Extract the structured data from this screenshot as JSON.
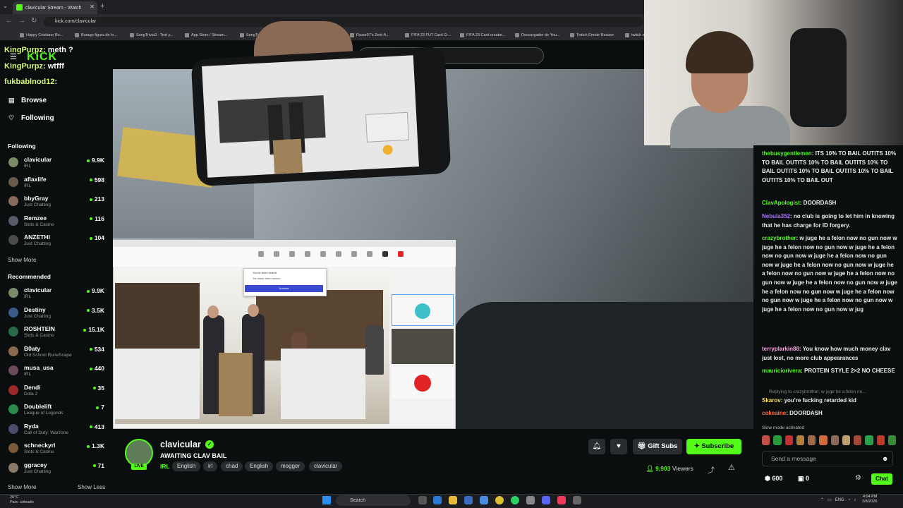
{
  "browser": {
    "tab_title": "clavicular Stream - Watch",
    "url": "kick.com/clavicular",
    "bookmarks": [
      "Happy Cristiano Ro...",
      "Burago figura de lo...",
      "SongTrivia2 - Test y...",
      "App Store / Stream...",
      "SongTrivia2 - Adivin...",
      "Pelotools v26.0.28",
      "Razor97's Zest-A...",
      "FIFA 23 FUT Card Cr...",
      "FIFA 23 Card creator...",
      "Descargador de You...",
      "Twitch Emote Resizer",
      "twitch emote r..."
    ]
  },
  "header": {
    "logo": "KICK",
    "search_placeholder": "Search"
  },
  "overlay_chat": [
    {
      "user": "KingPurpz",
      "text": ": meth ?"
    },
    {
      "user": "KingPurpz",
      "text": ": wtfff"
    },
    {
      "user": "fukbablnod12",
      "text": ":"
    }
  ],
  "sidebar": {
    "browse": "Browse",
    "following_nav": "Following",
    "following_header": "Following",
    "following": [
      {
        "name": "clavicular",
        "category": "IRL",
        "viewers": "9.9K",
        "color": "#7a8b6a"
      },
      {
        "name": "aflaxlife",
        "category": "IRL",
        "viewers": "598",
        "color": "#6b5a4a"
      },
      {
        "name": "bbyGray",
        "category": "Just Chatting",
        "viewers": "213",
        "color": "#8a6a5a"
      },
      {
        "name": "Remzee",
        "category": "Slots & Casino",
        "viewers": "116",
        "color": "#5a5a6a"
      },
      {
        "name": "ANZETHI",
        "category": "Just Chatting",
        "viewers": "104",
        "color": "#4a4a4a"
      }
    ],
    "show_more_1": "Show More",
    "recommended_header": "Recommended",
    "recommended": [
      {
        "name": "clavicular",
        "category": "IRL",
        "viewers": "9.9K",
        "color": "#7a8b6a"
      },
      {
        "name": "Destiny",
        "category": "Just Chatting",
        "viewers": "3.5K",
        "color": "#3a5a8a"
      },
      {
        "name": "ROSHTEIN",
        "category": "Slots & Casino",
        "viewers": "15.1K",
        "color": "#2a6a4a"
      },
      {
        "name": "B0aty",
        "category": "Old School RuneScape",
        "viewers": "534",
        "color": "#8a6a4a"
      },
      {
        "name": "musa_usa",
        "category": "IRL",
        "viewers": "440",
        "color": "#6a4a5a"
      },
      {
        "name": "Dendi",
        "category": "Dota 2",
        "viewers": "35",
        "color": "#9a2a2a"
      },
      {
        "name": "Doublelift",
        "category": "League of Legends",
        "viewers": "7",
        "color": "#2a8a4a"
      },
      {
        "name": "Ryda",
        "category": "Call of Duty: Warzone",
        "viewers": "413",
        "color": "#4a4a6a"
      },
      {
        "name": "schneckyrl",
        "category": "Slots & Casino",
        "viewers": "1.3K",
        "color": "#7a5a3a"
      },
      {
        "name": "ggracey",
        "category": "Just Chatting",
        "viewers": "71",
        "color": "#8a7a6a"
      }
    ],
    "show_more_2": "Show More",
    "show_less": "Show Less"
  },
  "zoom": {
    "dialog_title": "You've been muted",
    "dialog_text": "You have been muted.",
    "dialog_button": "Unmute"
  },
  "chat": {
    "messages": [
      {
        "user": "thebusygentlemen",
        "uclass": "u",
        "text": ": ITS 10% TO BAIL OUTITS 10% TO BAIL OUTITS 10% TO BAIL OUTITS 10% TO BAIL OUTITS 10% TO BAIL OUTITS 10% TO BAIL OUTITS 10% TO BAIL OUT"
      },
      {
        "user": "ClavApologist",
        "uclass": "u",
        "text": ": DOORDASH"
      },
      {
        "user": "Nebula352",
        "uclass": "u2",
        "text": ": no club is going to let him in knowing that he has charge for ID forgery."
      },
      {
        "user": "crazybrother",
        "uclass": "u",
        "text": ": w juge he a felon now no gun now w juge he a felon now no gun now w juge he a felon now no gun now w juge he a felon now no gun now w juge he a felon now no gun now w juge he a felon now no gun now w juge he a felon now no gun now w juge he a felon now no gun now w juge he a felon now no gun now w juge he a felon now no gun now w juge he a felon now no gun now w juge he a felon now no gun now w jug"
      },
      {
        "user": "terryplarkin88",
        "uclass": "u3",
        "text": ": You know how much money clav just lost, no more club appearances"
      },
      {
        "user": "mauriciorivera",
        "uclass": "u",
        "text": ": PROTEIN STYLE 2×2 NO CHEESE"
      },
      {
        "user": "Skarov",
        "uclass": "u5",
        "text": ": you're fucking retarded kid"
      },
      {
        "user": "cokeaine",
        "uclass": "u4",
        "text": ": DOORDASH"
      }
    ],
    "reply_text": "Replying to crazybrother: w juge he a felon no...",
    "slow_mode": "Slow mode activated",
    "send_placeholder": "Send a message",
    "points": "600",
    "points2": "0",
    "chat_button": "Chat",
    "emote_colors": [
      "#c0504a",
      "#2a9a3a",
      "#c03030",
      "#b0803a",
      "#a06a4a",
      "#d06a3a",
      "#8a6a5a",
      "#c0a070",
      "#a04a3a",
      "#2aa04a",
      "#c03a2a",
      "#3a8a3a"
    ]
  },
  "channel": {
    "name": "clavicular",
    "title": "AWAITING CLAV BAIL",
    "category": "IRL",
    "tags": [
      "English",
      "irl",
      "chad",
      "English",
      "mogger",
      "clavicular"
    ],
    "live": "LIVE",
    "gift_label": "Gift Subs",
    "subscribe_label": "Subscribe",
    "viewers": "9,903",
    "viewers_label": "Viewers"
  },
  "taskbar": {
    "weather_temp": "26°C",
    "weather_desc": "Parc. soleado",
    "search": "Search",
    "lang": "ENG",
    "time": "4:04 PM",
    "date": "2/8/2026"
  },
  "colors": {
    "accent": "#53fc18",
    "background": "#0b0e0f"
  }
}
